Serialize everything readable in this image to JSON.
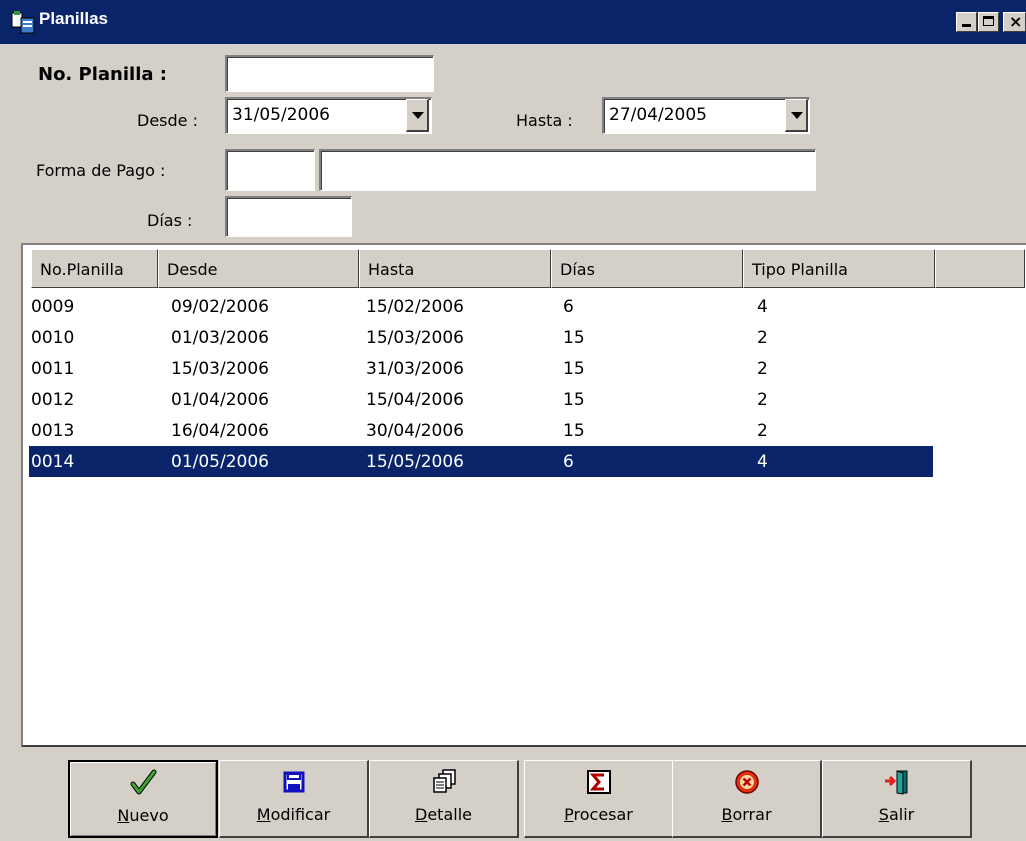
{
  "window": {
    "title": "Planillas",
    "min_label": "_",
    "max_label": "□",
    "close_label": "×"
  },
  "form": {
    "no_planilla_label": "No. Planilla :",
    "no_planilla_value": "",
    "desde_label": "Desde :",
    "desde_value": "31/05/2006",
    "hasta_label": "Hasta :",
    "hasta_value": "27/04/2005",
    "forma_pago_label": "Forma de Pago :",
    "forma_pago_code": "",
    "forma_pago_desc": "",
    "dias_label": "Días :",
    "dias_value": ""
  },
  "table": {
    "columns": [
      "No.Planilla",
      "Desde",
      "Hasta",
      "Días",
      "Tipo Planilla"
    ],
    "rows": [
      [
        "0009",
        "09/02/2006",
        "15/02/2006",
        "6",
        "4"
      ],
      [
        "0010",
        "01/03/2006",
        "15/03/2006",
        "15",
        "2"
      ],
      [
        "0011",
        "15/03/2006",
        "31/03/2006",
        "15",
        "2"
      ],
      [
        "0012",
        "01/04/2006",
        "15/04/2006",
        "15",
        "2"
      ],
      [
        "0013",
        "16/04/2006",
        "30/04/2006",
        "15",
        "2"
      ],
      [
        "0014",
        "01/05/2006",
        "15/05/2006",
        "6",
        "4"
      ]
    ],
    "selected_index": 5
  },
  "buttons": {
    "nuevo": {
      "key": "N",
      "rest": "uevo",
      "icon": "checkmark-icon"
    },
    "modificar": {
      "key": "M",
      "rest": "odificar",
      "icon": "save-icon"
    },
    "detalle": {
      "key": "D",
      "rest": "etalle",
      "icon": "documents-icon"
    },
    "procesar": {
      "key": "P",
      "rest": "rocesar",
      "icon": "sigma-icon"
    },
    "borrar": {
      "key": "B",
      "rest": "orrar",
      "icon": "delete-icon"
    },
    "salir": {
      "key": "S",
      "rest": "alir",
      "icon": "exit-door-icon"
    }
  },
  "colors": {
    "titlebar": "#0a246a",
    "selection": "#0a246a",
    "face": "#d4d0c8"
  }
}
